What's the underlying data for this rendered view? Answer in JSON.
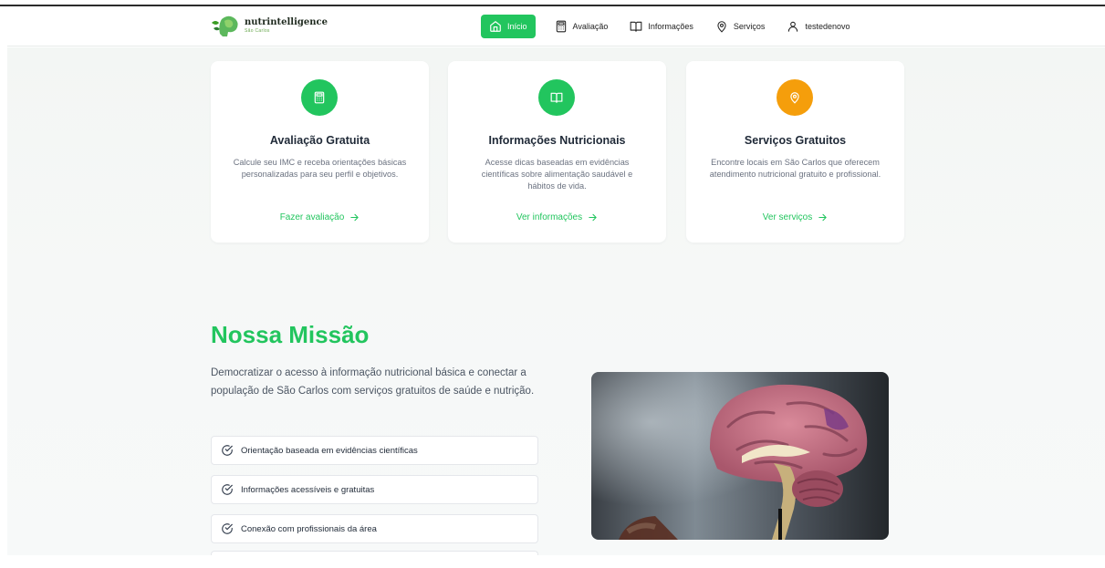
{
  "header": {
    "logo_title": "nutrintelligence",
    "logo_subtitle": "São Carlos",
    "nav": [
      {
        "label": "Início",
        "icon": "home-icon",
        "active": true
      },
      {
        "label": "Avaliação",
        "icon": "calculator-icon",
        "active": false
      },
      {
        "label": "Informações",
        "icon": "book-icon",
        "active": false
      },
      {
        "label": "Serviços",
        "icon": "location-pin-icon",
        "active": false
      },
      {
        "label": "testedenovo",
        "icon": "user-icon",
        "active": false
      }
    ]
  },
  "cards": [
    {
      "title": "Avaliação Gratuita",
      "description": "Calcule seu IMC e receba orientações básicas personalizadas para seu perfil e objetivos.",
      "link": "Fazer avaliação",
      "icon": "calculator-icon",
      "icon_color": "#22c55e"
    },
    {
      "title": "Informações Nutricionais",
      "description": "Acesse dicas baseadas em evidências científicas sobre alimentação saudável e hábitos de vida.",
      "link": "Ver informações",
      "icon": "book-icon",
      "icon_color": "#22c55e"
    },
    {
      "title": "Serviços Gratuitos",
      "description": "Encontre locais em São Carlos que oferecem atendimento nutricional gratuito e profissional.",
      "link": "Ver serviços",
      "icon": "location-pin-icon",
      "icon_color": "#f59e0b"
    }
  ],
  "mission": {
    "title": "Nossa Missão",
    "text": "Democratizar o acesso à informação nutricional básica e conectar a população de São Carlos com serviços gratuitos de saúde e nutrição.",
    "items": [
      "Orientação baseada em evidências científicas",
      "Informações acessíveis e gratuitas",
      "Conexão com profissionais da área"
    ],
    "image": "brain-model-photo"
  },
  "colors": {
    "accent": "#22c55e",
    "services_icon": "#f59e0b"
  }
}
